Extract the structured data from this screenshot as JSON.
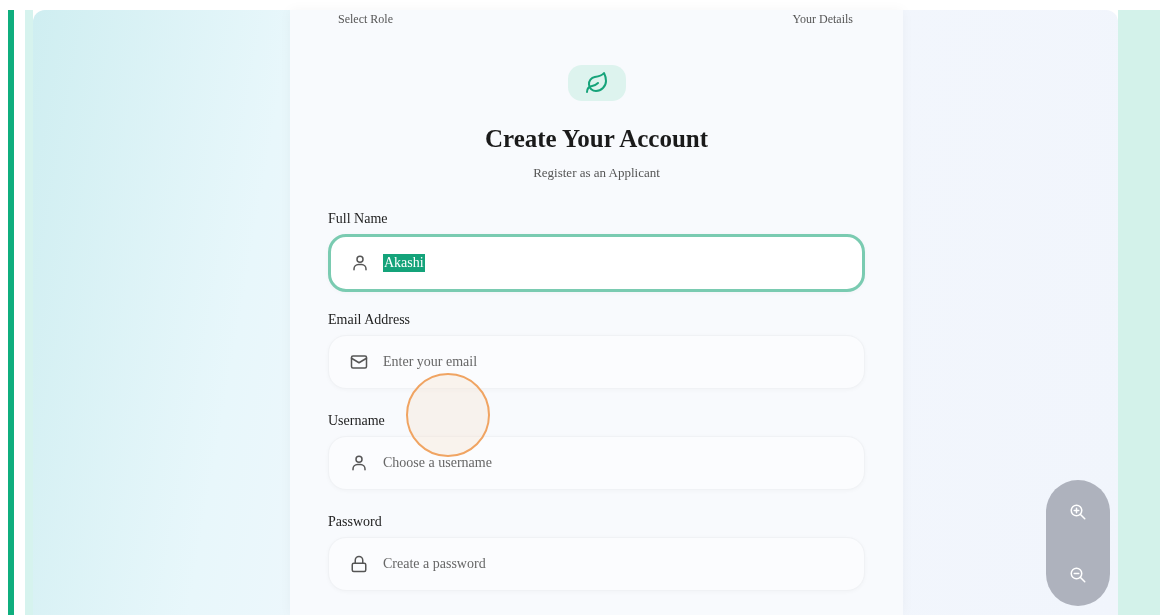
{
  "steps": [
    {
      "label": "Select Role"
    },
    {
      "label": "Your Details"
    }
  ],
  "title": "Create Your Account",
  "subtitle": "Register as an Applicant",
  "fields": [
    {
      "label": "Full Name",
      "kind": "user",
      "value": "Akashi",
      "focused": true,
      "text_highlighted": true
    },
    {
      "label": "Email Address",
      "kind": "mail",
      "placeholder": "Enter your email",
      "focused": false
    },
    {
      "label": "Username",
      "kind": "user",
      "placeholder": "Choose a username",
      "focused": false
    },
    {
      "label": "Password",
      "kind": "lock",
      "placeholder": "Create a password",
      "focused": false
    }
  ]
}
